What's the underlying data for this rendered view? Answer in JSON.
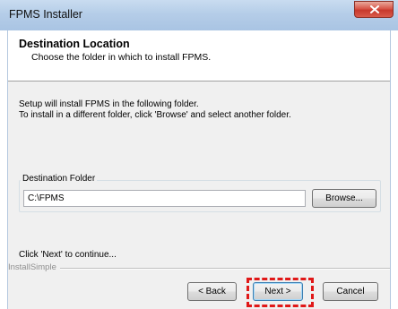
{
  "window": {
    "title": "FPMS Installer"
  },
  "header": {
    "title": "Destination Location",
    "subtitle": "Choose the folder in which to install FPMS."
  },
  "body": {
    "line1": "Setup will install FPMS in the following folder.",
    "line2": "To install in a different folder, click 'Browse' and select another folder.",
    "group_label": "Destination Folder",
    "folder_value": "C:\\FPMS",
    "browse_label": "Browse...",
    "continue_text": "Click 'Next' to continue..."
  },
  "footer": {
    "brand": "InstallSimple",
    "back_label": "< Back",
    "next_label": "Next >",
    "cancel_label": "Cancel"
  },
  "colors": {
    "highlight": "#e01818",
    "titlebar": "#b5cde8",
    "close_button": "#d8574a"
  }
}
